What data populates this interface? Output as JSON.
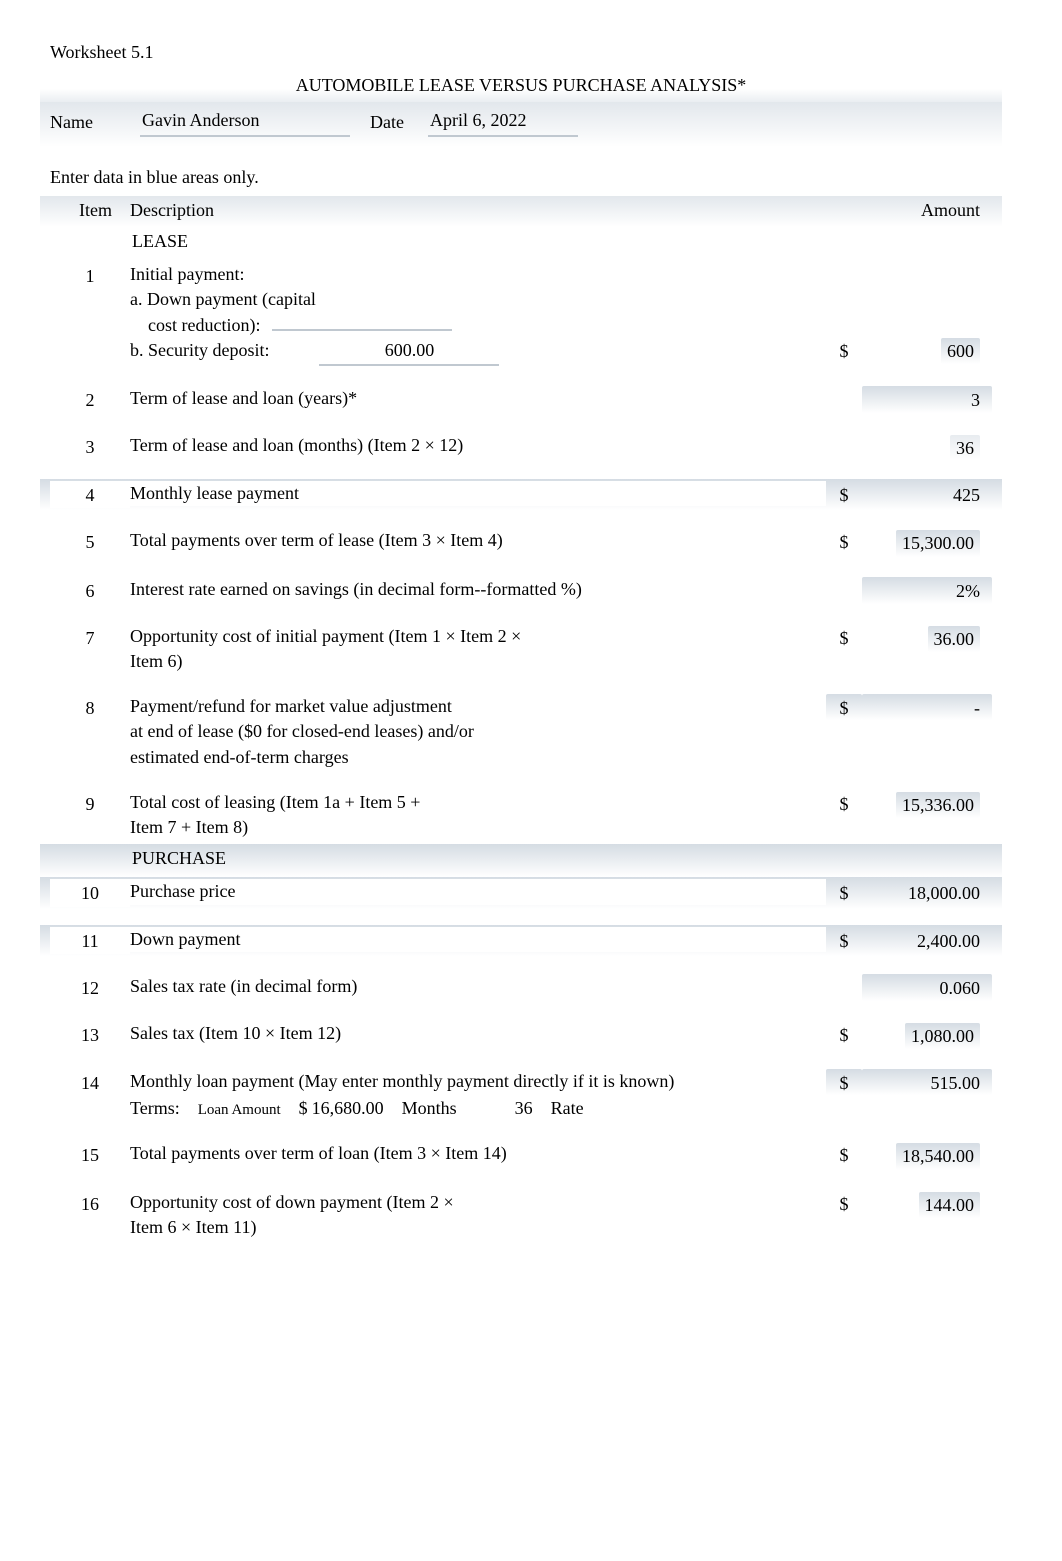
{
  "worksheet_label": "Worksheet 5.1",
  "title": "AUTOMOBILE LEASE VERSUS PURCHASE ANALYSIS*",
  "header": {
    "name_label": "Name",
    "name_value": "Gavin Anderson",
    "date_label": "Date",
    "date_value": "April 6, 2022"
  },
  "instruction": "Enter data in blue areas only.",
  "columns": {
    "item": "Item",
    "description": "Description",
    "amount": "Amount"
  },
  "lease": {
    "section": "LEASE",
    "items": {
      "i1": {
        "num": "1",
        "desc": "Initial payment:",
        "a_label": "a. Down payment (capital",
        "a_label2": "cost reduction):",
        "a_value": "",
        "b_label": "b. Security deposit:",
        "b_value": "600.00",
        "cur": "$",
        "amount": "600"
      },
      "i2": {
        "num": "2",
        "desc": "Term of lease and loan (years)*",
        "amount": "3"
      },
      "i3": {
        "num": "3",
        "desc": "Term of lease and loan (months) (Item 2 × 12)",
        "amount": "36"
      },
      "i4": {
        "num": "4",
        "desc": "Monthly lease payment",
        "cur": "$",
        "amount": "425"
      },
      "i5": {
        "num": "5",
        "desc": "Total payments over term of lease (Item 3 × Item 4)",
        "cur": "$",
        "amount": "15,300.00"
      },
      "i6": {
        "num": "6",
        "desc": "Interest rate earned on savings (in decimal form--formatted %)",
        "amount": "2%"
      },
      "i7": {
        "num": "7",
        "desc": "Opportunity cost of initial payment (Item 1 × Item 2 ×",
        "desc2": "Item 6)",
        "cur": "$",
        "amount": "36.00"
      },
      "i8": {
        "num": "8",
        "desc": "Payment/refund for market value adjustment",
        "desc2": "at end of lease ($0 for closed-end leases) and/or",
        "desc3": "estimated end-of-term charges",
        "cur": "$",
        "amount": "-"
      },
      "i9": {
        "num": "9",
        "desc": "Total cost of leasing (Item 1a + Item 5 +",
        "desc2": "Item 7 + Item 8)",
        "cur": "$",
        "amount": "15,336.00"
      }
    }
  },
  "purchase": {
    "section": "PURCHASE",
    "items": {
      "i10": {
        "num": "10",
        "desc": "Purchase price",
        "cur": "$",
        "amount": "18,000.00"
      },
      "i11": {
        "num": "11",
        "desc": "Down payment",
        "cur": "$",
        "amount": "2,400.00"
      },
      "i12": {
        "num": "12",
        "desc": "Sales tax rate (in decimal form)",
        "amount": "0.060"
      },
      "i13": {
        "num": "13",
        "desc": "Sales tax (Item 10 × Item 12)",
        "cur": "$",
        "amount": "1,080.00"
      },
      "i14": {
        "num": "14",
        "desc": "Monthly loan payment  (May enter monthly payment directly if it is known)",
        "terms_label": "Terms:",
        "loan_amt_label": "Loan Amount",
        "loan_amt_cur": "$",
        "loan_amt_val": "16,680.00",
        "months_label": "Months",
        "months_val": "36",
        "rate_label": "Rate",
        "cur": "$",
        "amount": "515.00"
      },
      "i15": {
        "num": "15",
        "desc": "Total payments over term of loan (Item 3 × Item 14)",
        "cur": "$",
        "amount": "18,540.00"
      },
      "i16": {
        "num": "16",
        "desc": "Opportunity cost of down payment (Item 2 ×",
        "desc2": "Item 6 × Item 11)",
        "cur": "$",
        "amount": "144.00"
      }
    }
  }
}
